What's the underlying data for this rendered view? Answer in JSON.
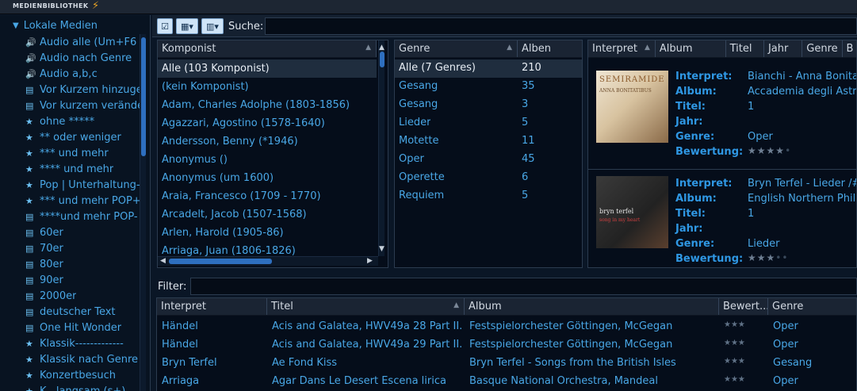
{
  "titlebar": {
    "title": "MEDIENBIBLIOTHEK",
    "bolt": "⚡"
  },
  "sidebar": {
    "root_label": "Lokale Medien",
    "items": [
      {
        "icon": "speaker-icon",
        "glyph": "🔊",
        "label": "Audio alle  (Um+F6"
      },
      {
        "icon": "speaker-icon",
        "glyph": "🔊",
        "label": "Audio nach Genre"
      },
      {
        "icon": "speaker-icon",
        "glyph": "🔊",
        "label": "Audio a,b,c"
      },
      {
        "icon": "playlist-new-icon",
        "glyph": "▤",
        "label": "Vor Kurzem hinzuge"
      },
      {
        "icon": "playlist-changed-icon",
        "glyph": "▤",
        "label": "Vor kurzem veränder"
      },
      {
        "icon": "star-playlist-icon",
        "glyph": "★",
        "label": "ohne *****"
      },
      {
        "icon": "star-playlist-icon",
        "glyph": "★",
        "label": "** oder weniger"
      },
      {
        "icon": "star-playlist-icon",
        "glyph": "★",
        "label": "*** und mehr"
      },
      {
        "icon": "star-playlist-icon",
        "glyph": "★",
        "label": "**** und mehr"
      },
      {
        "icon": "star-playlist-icon",
        "glyph": "★",
        "label": "Pop | Unterhaltung-"
      },
      {
        "icon": "star-playlist-icon",
        "glyph": "★",
        "label": "*** und mehr POP+"
      },
      {
        "icon": "playlist-icon",
        "glyph": "▤",
        "label": "****und mehr POP-"
      },
      {
        "icon": "playlist-icon",
        "glyph": "▤",
        "label": "60er"
      },
      {
        "icon": "playlist-icon",
        "glyph": "▤",
        "label": "70er"
      },
      {
        "icon": "playlist-icon",
        "glyph": "▤",
        "label": "80er"
      },
      {
        "icon": "playlist-icon",
        "glyph": "▤",
        "label": "90er"
      },
      {
        "icon": "playlist-icon",
        "glyph": "▤",
        "label": "2000er"
      },
      {
        "icon": "playlist-icon",
        "glyph": "▤",
        "label": "deutscher Text"
      },
      {
        "icon": "playlist-icon",
        "glyph": "▤",
        "label": "One Hit Wonder"
      },
      {
        "icon": "star-playlist-icon",
        "glyph": "★",
        "label": "Klassik-------------"
      },
      {
        "icon": "star-playlist-icon",
        "glyph": "★",
        "label": "Klassik nach Genre"
      },
      {
        "icon": "star-playlist-icon",
        "glyph": "★",
        "label": "Konzertbesuch"
      },
      {
        "icon": "star-playlist-icon",
        "glyph": "★",
        "label": "K...langsam (s+)"
      }
    ]
  },
  "toolbar": {
    "search_label": "Suche:",
    "search_value": ""
  },
  "composer_panel": {
    "header": "Komponist",
    "rows": [
      "Alle (103 Komponist)",
      "(kein Komponist)",
      "Adam, Charles Adolphe (1803-1856)",
      "Agazzari, Agostino (1578-1640)",
      "Andersson, Benny (*1946)",
      "Anonymus ()",
      "Anonymus (um 1600)",
      "Araia, Francesco  (1709 - 1770)",
      "Arcadelt, Jacob (1507-1568)",
      "Arlen, Harold (1905-86)",
      "Arriaga, Juan (1806-1826)"
    ]
  },
  "genre_panel": {
    "header_genre": "Genre",
    "header_albums": "Alben",
    "rows": [
      {
        "genre": "Alle (7 Genres)",
        "albums": "210"
      },
      {
        "genre": "Gesang",
        "albums": "35"
      },
      {
        "genre": "Gesang",
        "albums": "3"
      },
      {
        "genre": "Lieder",
        "albums": "5"
      },
      {
        "genre": "Motette",
        "albums": "11"
      },
      {
        "genre": "Oper",
        "albums": "45"
      },
      {
        "genre": "Operette",
        "albums": "6"
      },
      {
        "genre": "Requiem",
        "albums": "5"
      }
    ]
  },
  "album_panel": {
    "headers": [
      "Interpret",
      "Album",
      "Titel",
      "Jahr",
      "Genre",
      "B"
    ],
    "labels": {
      "interpret": "Interpret:",
      "album": "Album:",
      "titel": "Titel:",
      "jahr": "Jahr:",
      "genre": "Genre:",
      "bewertung": "Bewertung:"
    },
    "cards": [
      {
        "cover_text": "SEMIRAMIDE",
        "cover_sub": "ANNA BONITATIBUS",
        "interpret": "Bianchi - Anna Bonitatib",
        "album": "Accademia degli Astrus",
        "titel": "1",
        "jahr": "",
        "genre": "Oper",
        "rating": 0.8
      },
      {
        "cover_text": "bryn terfel",
        "cover_sub": "song in my heart",
        "interpret": "Bryn Terfel  - Lieder /# A",
        "album": "English Northern Philha",
        "titel": "1",
        "jahr": "",
        "genre": "Lieder",
        "rating": 0.6
      }
    ]
  },
  "filter": {
    "label": "Filter:",
    "value": ""
  },
  "tracks": {
    "headers": [
      "Interpret",
      "Titel",
      "Album",
      "Bewert...",
      "Genre"
    ],
    "rows": [
      {
        "interpret": "Händel",
        "titel": "Acis and Galatea, HWV49a 28 Part II...",
        "album": "Festspielorchester Göttingen, McGegan",
        "rating": "★★★",
        "genre": "Oper"
      },
      {
        "interpret": "Händel",
        "titel": "Acis and Galatea, HWV49a 29 Part II...",
        "album": "Festspielorchester Göttingen, McGegan",
        "rating": "★★★",
        "genre": "Oper"
      },
      {
        "interpret": "Bryn Terfel",
        "titel": "Ae Fond Kiss",
        "album": "Bryn Terfel - Songs from the British Isles",
        "rating": "★★★",
        "genre": "Gesang"
      },
      {
        "interpret": "Arriaga",
        "titel": "Agar Dans Le Desert Escena lirica",
        "album": "Basque National Orchestra, Mandeal",
        "rating": "★★★",
        "genre": "Oper"
      }
    ]
  }
}
